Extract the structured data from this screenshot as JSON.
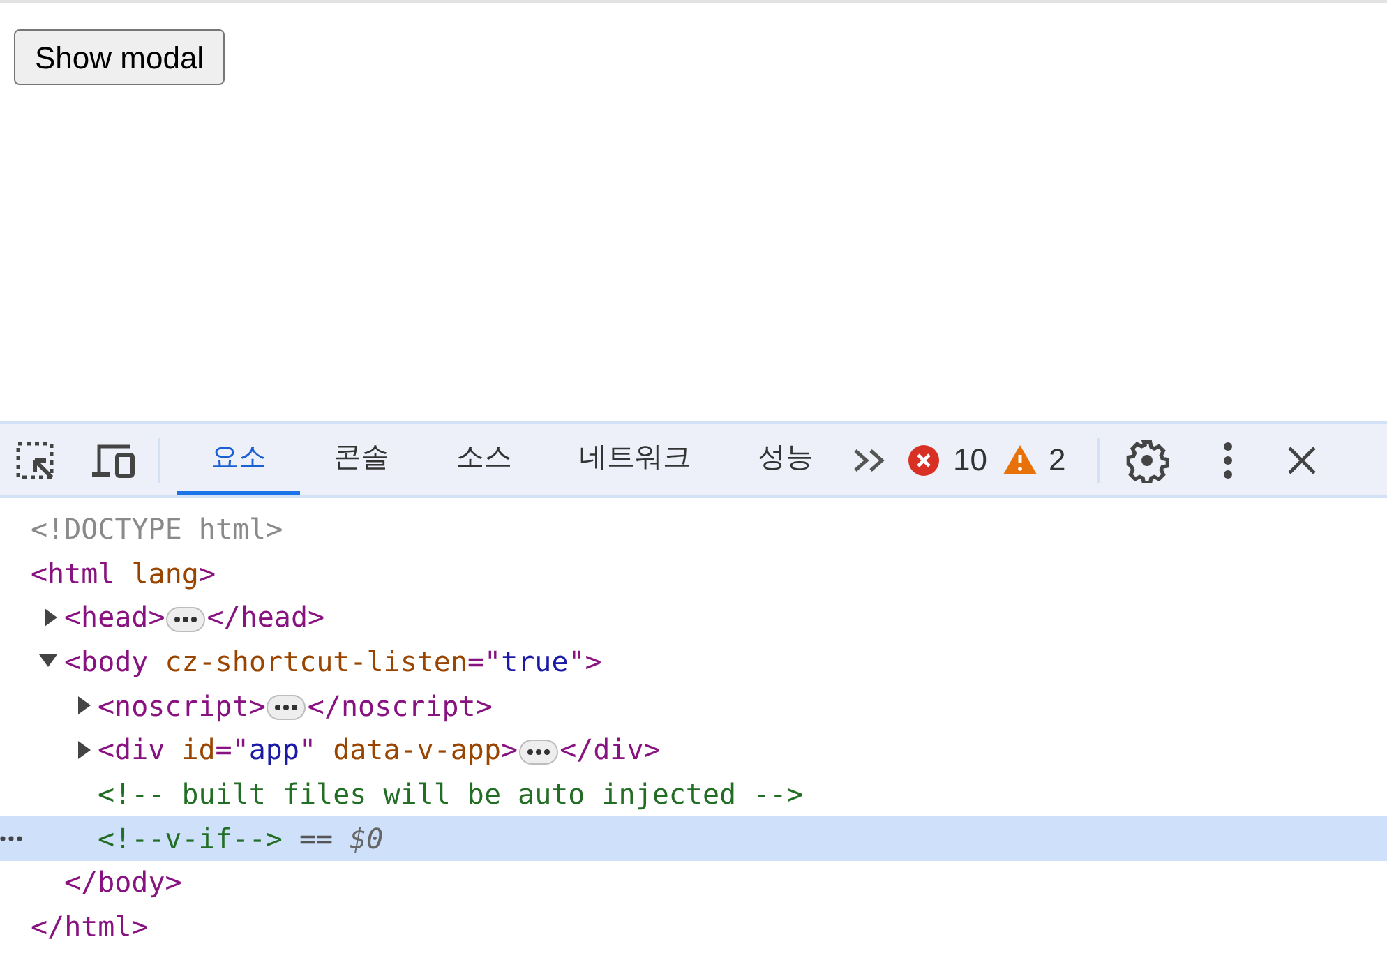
{
  "page": {
    "button": "Show modal"
  },
  "devtools": {
    "tabs": [
      {
        "label": "요소",
        "selected": true
      },
      {
        "label": "콘솔",
        "selected": false
      },
      {
        "label": "소스",
        "selected": false
      },
      {
        "label": "네트워크",
        "selected": false
      },
      {
        "label": "성능",
        "selected": false
      }
    ],
    "errors": "10",
    "warnings": "2",
    "dom_tree": [
      {
        "tokens": [
          {
            "kind": "doctype",
            "text": "<!DOCTYPE html>"
          }
        ],
        "selected": false
      },
      {
        "tokens": [
          {
            "kind": "tag",
            "text": "<html"
          },
          {
            "kind": "attr",
            "text": " lang"
          },
          {
            "kind": "tag",
            "text": ">"
          }
        ],
        "selected": false,
        "close": [
          {
            "kind": "tag",
            "text": "</html>"
          }
        ],
        "children": [
          {
            "expanded": false,
            "tokens": [
              {
                "kind": "tag",
                "text": "<head>"
              },
              {
                "kind": "ellipsis"
              },
              {
                "kind": "tag",
                "text": "</head>"
              }
            ],
            "selected": false
          },
          {
            "expanded": true,
            "tokens": [
              {
                "kind": "tag",
                "text": "<body"
              },
              {
                "kind": "attr",
                "text": " cz-shortcut-listen"
              },
              {
                "kind": "tag",
                "text": "=\""
              },
              {
                "kind": "value",
                "text": "true"
              },
              {
                "kind": "tag",
                "text": "\">"
              }
            ],
            "selected": false,
            "close": [
              {
                "kind": "tag",
                "text": "</body>"
              }
            ],
            "children": [
              {
                "expanded": false,
                "tokens": [
                  {
                    "kind": "tag",
                    "text": "<noscript>"
                  },
                  {
                    "kind": "ellipsis"
                  },
                  {
                    "kind": "tag",
                    "text": "</noscript>"
                  }
                ],
                "selected": false
              },
              {
                "expanded": false,
                "tokens": [
                  {
                    "kind": "tag",
                    "text": "<div"
                  },
                  {
                    "kind": "attr",
                    "text": " id"
                  },
                  {
                    "kind": "tag",
                    "text": "=\""
                  },
                  {
                    "kind": "value",
                    "text": "app"
                  },
                  {
                    "kind": "tag",
                    "text": "\""
                  },
                  {
                    "kind": "attr",
                    "text": " data-v-app"
                  },
                  {
                    "kind": "tag",
                    "text": ">"
                  },
                  {
                    "kind": "ellipsis"
                  },
                  {
                    "kind": "tag",
                    "text": "</div>"
                  }
                ],
                "selected": false
              },
              {
                "tokens": [
                  {
                    "kind": "comment",
                    "text": "<!-- built files will be auto injected -->"
                  }
                ],
                "selected": false
              },
              {
                "tokens": [
                  {
                    "kind": "comment",
                    "text": "<!--v-if-->"
                  },
                  {
                    "kind": "plain",
                    "text": " == "
                  },
                  {
                    "kind": "var",
                    "text": "$0"
                  }
                ],
                "selected": true
              }
            ]
          }
        ]
      }
    ]
  }
}
